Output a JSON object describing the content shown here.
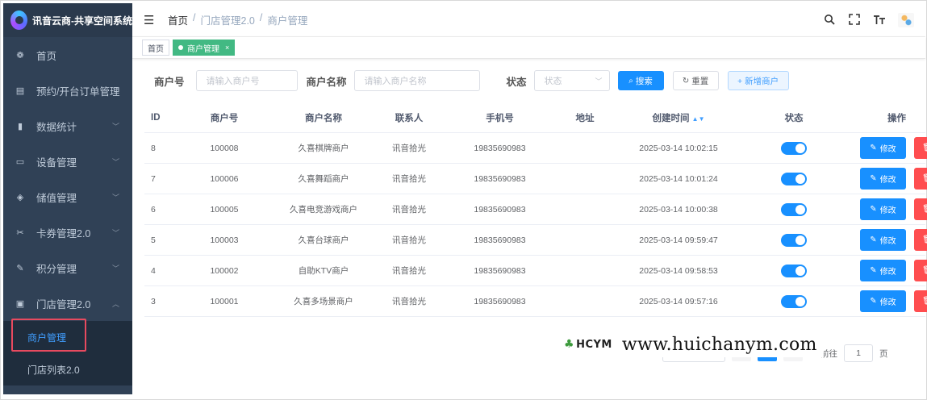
{
  "app": {
    "title": "讯音云商-共享空间系统"
  },
  "sidebar": {
    "items": [
      {
        "label": "首页",
        "icon": "dashboard-icon"
      },
      {
        "label": "预约/开台订单管理",
        "icon": "document-icon"
      },
      {
        "label": "数据统计",
        "icon": "chart-icon"
      },
      {
        "label": "设备管理",
        "icon": "calendar-icon"
      },
      {
        "label": "储值管理",
        "icon": "eye-icon"
      },
      {
        "label": "卡券管理2.0",
        "icon": "ticket-icon"
      },
      {
        "label": "积分管理",
        "icon": "edit-icon"
      },
      {
        "label": "门店管理2.0",
        "icon": "store-icon"
      }
    ],
    "sub_items": [
      {
        "label": "商户管理"
      },
      {
        "label": "门店列表2.0"
      }
    ]
  },
  "header": {
    "breadcrumb": [
      "首页",
      "/",
      "门店管理2.0",
      "/",
      "商户管理"
    ]
  },
  "tags": {
    "home": "首页",
    "current": "商户管理",
    "close": "×"
  },
  "search": {
    "merchant_no_label": "商户号",
    "merchant_no_placeholder": "请输入商户号",
    "merchant_name_label": "商户名称",
    "merchant_name_placeholder": "请输入商户名称",
    "status_label": "状态",
    "status_placeholder": "状态",
    "search_button": "搜索",
    "reset_button": "重置",
    "add_button": "+ 新增商户"
  },
  "table": {
    "headers": [
      "ID",
      "商户号",
      "商户名称",
      "联系人",
      "手机号",
      "地址",
      "创建时间",
      "状态",
      "操作"
    ],
    "edit_label": "修改",
    "delete_label": "删除",
    "rows": [
      {
        "id": "8",
        "no": "100008",
        "name": "久喜棋牌商户",
        "contact": "讯音拾光",
        "phone": "19835690983",
        "address": "",
        "time": "2025-03-14 10:02:15",
        "enabled": true
      },
      {
        "id": "7",
        "no": "100006",
        "name": "久喜舞蹈商户",
        "contact": "讯音拾光",
        "phone": "19835690983",
        "address": "",
        "time": "2025-03-14 10:01:24",
        "enabled": true
      },
      {
        "id": "6",
        "no": "100005",
        "name": "久喜电竞游戏商户",
        "contact": "讯音拾光",
        "phone": "19835690983",
        "address": "",
        "time": "2025-03-14 10:00:38",
        "enabled": true
      },
      {
        "id": "5",
        "no": "100003",
        "name": "久喜台球商户",
        "contact": "讯音拾光",
        "phone": "19835690983",
        "address": "",
        "time": "2025-03-14 09:59:47",
        "enabled": true
      },
      {
        "id": "4",
        "no": "100002",
        "name": "自助KTV商户",
        "contact": "讯音拾光",
        "phone": "19835690983",
        "address": "",
        "time": "2025-03-14 09:58:53",
        "enabled": true
      },
      {
        "id": "3",
        "no": "100001",
        "name": "久喜多场景商户",
        "contact": "讯音拾光",
        "phone": "19835690983",
        "address": "",
        "time": "2025-03-14 09:57:16",
        "enabled": true
      }
    ]
  },
  "pagination": {
    "goto_label": "前往",
    "page_value": "1",
    "page_unit": "页"
  },
  "watermark": {
    "logo_text": "HCYM",
    "url": "www.huichanym.com"
  },
  "colors": {
    "sidebar_bg": "#304156",
    "primary": "#1890ff",
    "danger": "#ff4d4f",
    "tag_active": "#42b983",
    "highlight_border": "#e84a5f"
  }
}
